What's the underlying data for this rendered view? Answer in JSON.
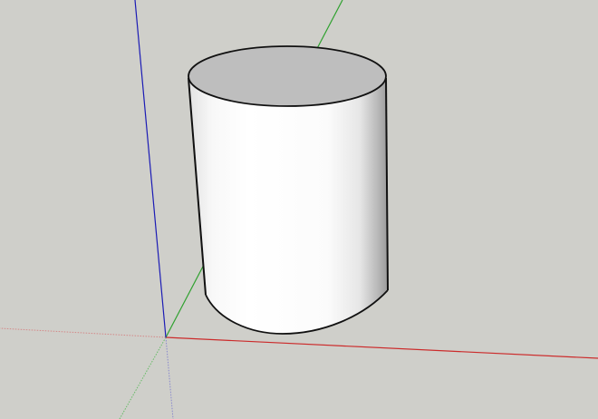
{
  "viewport": {
    "background_color": "#cfcfca",
    "interaction": "3d-modeling-canvas"
  },
  "axes": {
    "x_axis_color": "#cc2b2b",
    "y_axis_color": "#2fa12f",
    "z_axis_color": "#1b1bb5"
  },
  "model": {
    "shape": "cylinder",
    "side_color": "#ffffff",
    "top_face_color": "#bebebe",
    "edge_color": "#111111"
  }
}
